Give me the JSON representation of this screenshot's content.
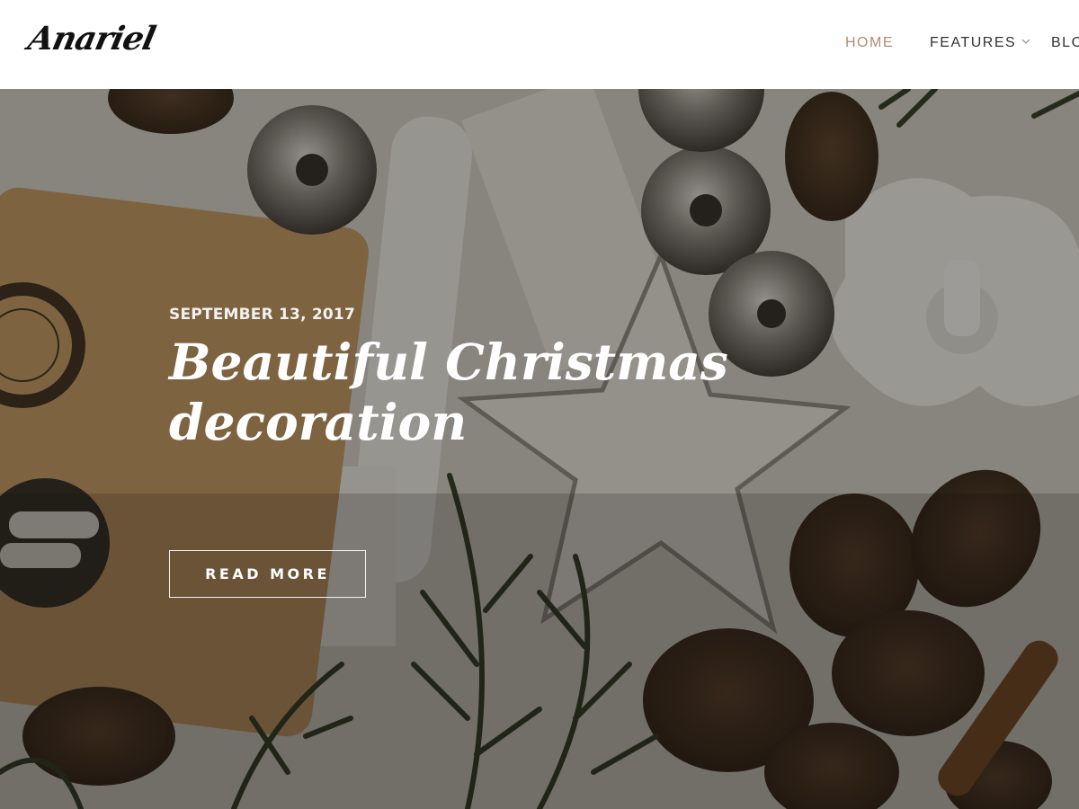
{
  "site": {
    "logo_text": "Anariel"
  },
  "nav": {
    "items": [
      {
        "label": "HOME",
        "active": true
      },
      {
        "label": "FEATURES",
        "has_dropdown": true
      },
      {
        "label": "BLOG"
      }
    ]
  },
  "hero": {
    "date": "SEPTEMBER 13, 2017",
    "title": "Beautiful Christmas decoration",
    "button_label": "READ MORE"
  },
  "colors": {
    "accent": "#b38b70",
    "nav_text": "#333333",
    "overlay": "#1a1814"
  }
}
